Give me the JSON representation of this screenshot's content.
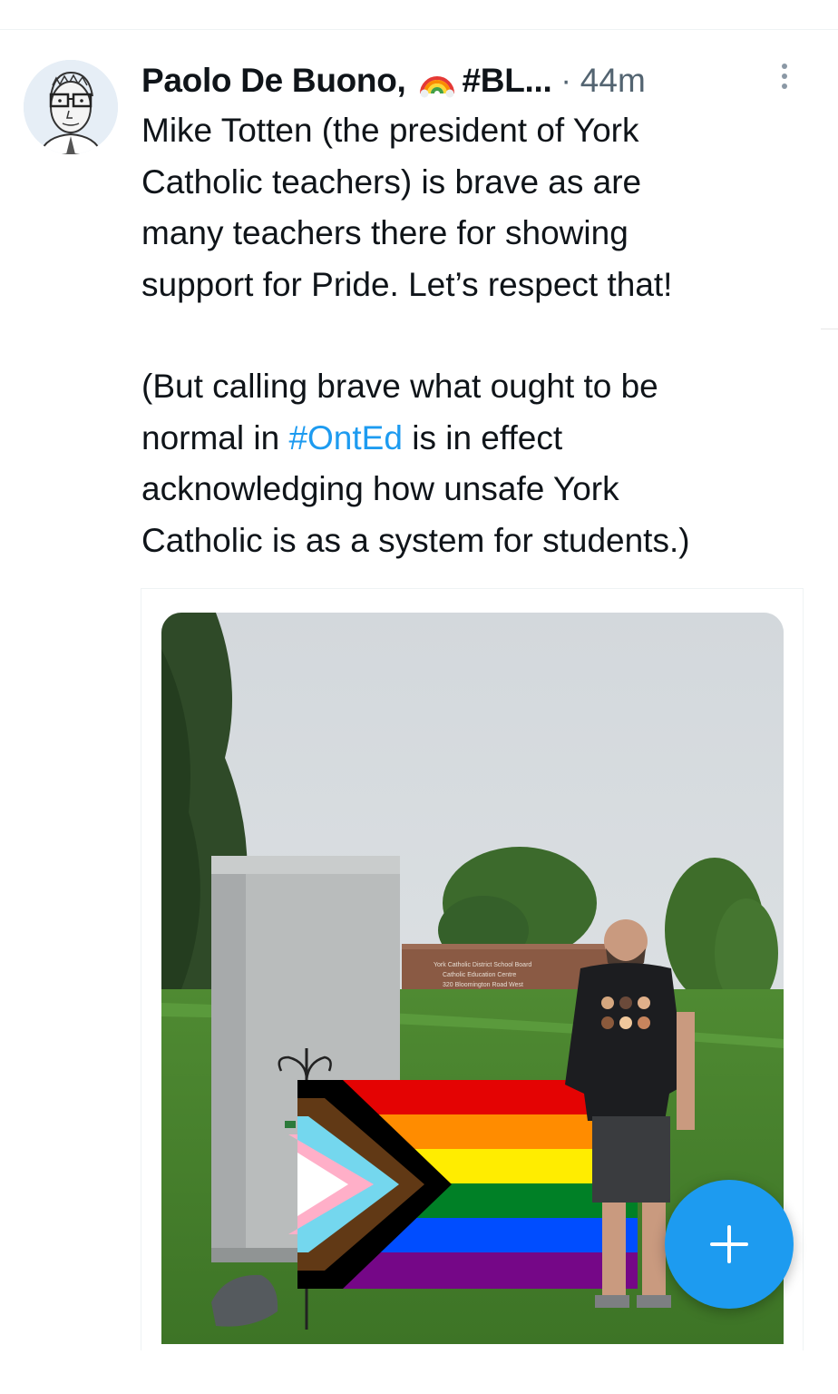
{
  "tweet": {
    "author_name": "Paolo De Buono,",
    "author_emoji": "rainbow-emoji",
    "author_tag": "#BL...",
    "separator": "·",
    "timestamp": "44m",
    "text": {
      "line1": "Mike Totten (the president of York",
      "line2": "Catholic teachers) is brave as are",
      "line3": "many teachers there for showing",
      "line4": "support for Pride. Let’s respect that!",
      "line5": "(But calling brave what ought to be",
      "line6_pre": "normal in ",
      "line6_hashtag": "#OntEd",
      "line6_post": " is in effect",
      "line7": "acknowledging how unsafe York",
      "line8": "Catholic is as a system for students.)"
    },
    "media": {
      "sign_line1": "York Catholic District School Board",
      "sign_line2": "Catholic Education Centre",
      "sign_line3": "320 Bloomington Road West"
    }
  },
  "icons": {
    "more": "more-vertical-icon",
    "compose": "plus-icon"
  },
  "colors": {
    "accent": "#1d9bf0",
    "text": "#0f1419",
    "muted": "#536471"
  }
}
